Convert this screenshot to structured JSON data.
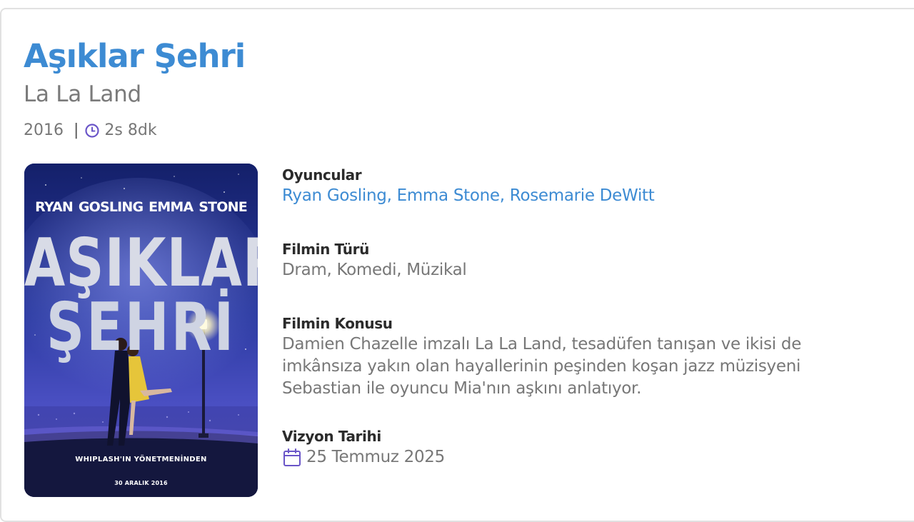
{
  "movie": {
    "title": "Aşıklar Şehri",
    "original_title": "La La Land",
    "year": "2016",
    "separator": "|",
    "duration": "2s 8dk",
    "accent_color": "#3d8bd3",
    "icon_color": "#6a55c8"
  },
  "poster": {
    "actors": "RYAN GOSLING   EMMA STONE",
    "title_line_1": "AŞIKLAR",
    "title_line_2": "ŞEHRİ",
    "tagline": "WHIPLASH'IN YÖNETMENİNDEN",
    "date": "30 ARALIK 2016"
  },
  "details": {
    "cast_label": "Oyuncular",
    "cast": [
      {
        "name": "Ryan Gosling"
      },
      {
        "name": "Emma Stone"
      },
      {
        "name": "Rosemarie DeWitt"
      }
    ],
    "cast_separator": ", ",
    "genre_label": "Filmin Türü",
    "genres": "Dram, Komedi, Müzikal",
    "plot_label": "Filmin Konusu",
    "plot": "Damien Chazelle imzalı La La Land, tesadüfen tanışan ve ikisi de imkânsıza yakın olan hayallerinin peşinden koşan jazz müzisyeni Sebastian ile oyuncu Mia'nın aşkını anlatıyor.",
    "release_label": "Vizyon Tarihi",
    "release_date": "25 Temmuz 2025"
  },
  "icons": {
    "duration": "clock-icon",
    "release": "calendar-icon"
  }
}
